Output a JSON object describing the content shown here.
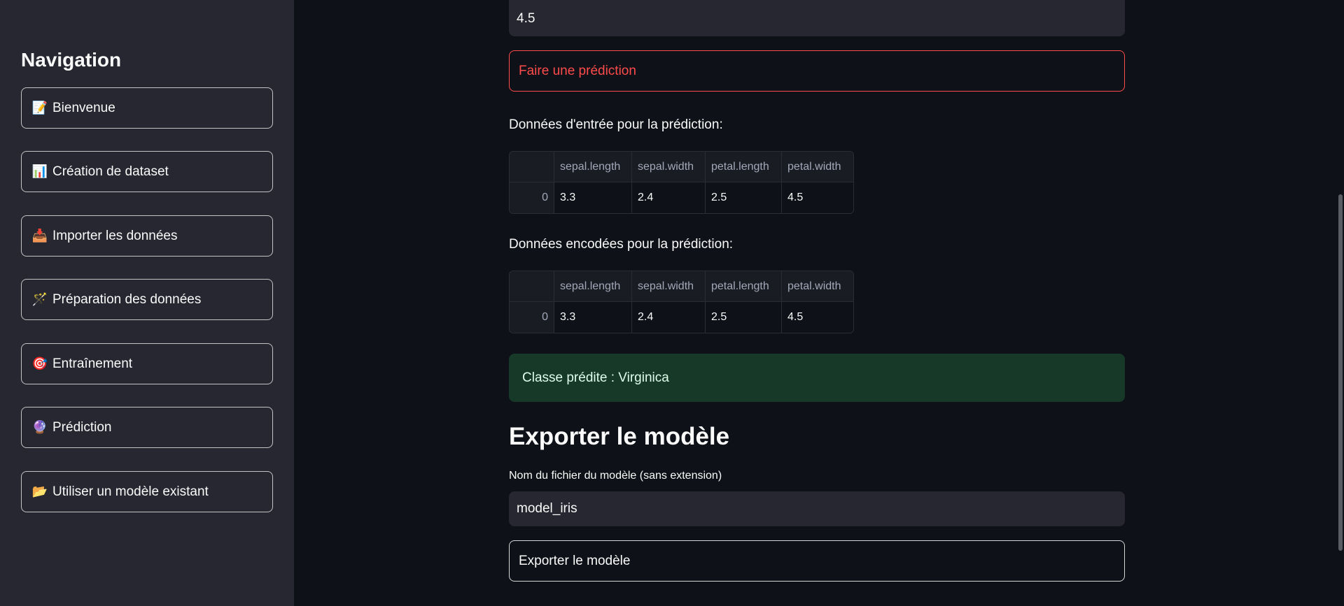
{
  "sidebar": {
    "title": "Navigation",
    "items": [
      {
        "emoji": "📝",
        "label": "Bienvenue"
      },
      {
        "emoji": "📊",
        "label": "Création de dataset"
      },
      {
        "emoji": "📥",
        "label": "Importer les données"
      },
      {
        "emoji": "🪄",
        "label": "Préparation des données"
      },
      {
        "emoji": "🎯",
        "label": "Entraînement"
      },
      {
        "emoji": "🔮",
        "label": "Prédiction"
      },
      {
        "emoji": "📂",
        "label": "Utiliser un modèle existant"
      }
    ]
  },
  "main": {
    "top_input_value": "4.5",
    "predict_button": "Faire une prédiction",
    "input_table_label": "Données d'entrée pour la prédiction:",
    "encoded_table_label": "Données encodées pour la prédiction:",
    "input_table": {
      "columns": [
        "",
        "sepal.length",
        "sepal.width",
        "petal.length",
        "petal.width"
      ],
      "rows": [
        [
          "0",
          "3.3",
          "2.4",
          "2.5",
          "4.5"
        ]
      ]
    },
    "encoded_table": {
      "columns": [
        "",
        "sepal.length",
        "sepal.width",
        "petal.length",
        "petal.width"
      ],
      "rows": [
        [
          "0",
          "3.3",
          "2.4",
          "2.5",
          "4.5"
        ]
      ]
    },
    "prediction_result": "Classe prédite : Virginica",
    "export_heading": "Exporter le modèle",
    "filename_label": "Nom du fichier du modèle (sans extension)",
    "filename_value": "model_iris",
    "export_button": "Exporter le modèle"
  },
  "colors": {
    "background": "#0e1117",
    "sidebar": "#262730",
    "accent": "#ff4b4b",
    "success_bg": "#173928"
  }
}
